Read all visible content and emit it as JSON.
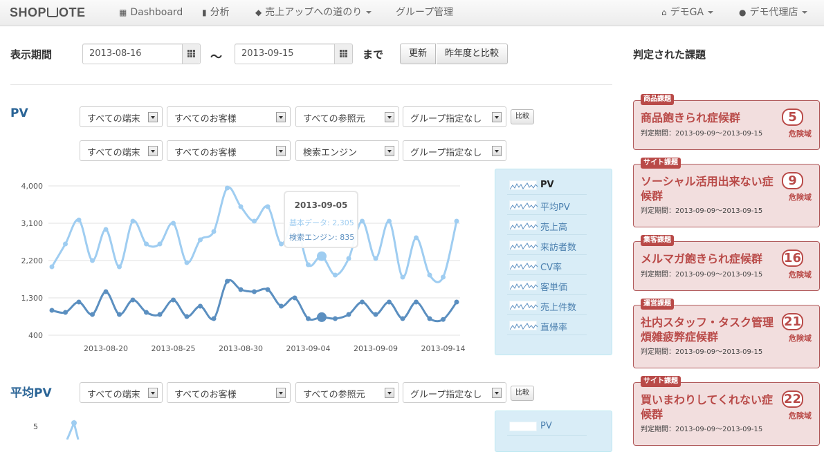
{
  "nav": {
    "brand": "SHOPNOTE",
    "brand_left": "SHOP",
    "brand_right": "OTE",
    "brand_icon": "cart-icon",
    "dashboard": "Dashboard",
    "analysis": "分析",
    "road": "売上アップへの道のり",
    "group": "グループ管理",
    "account": "デモGA",
    "agency": "デモ代理店"
  },
  "period": {
    "label": "表示期間",
    "from": "2013-08-16",
    "tilde": "〜",
    "to": "2013-09-15",
    "until": "まで",
    "refresh": "更新",
    "compare_last_year": "昨年度と比較"
  },
  "pv_section": {
    "title": "PV",
    "filter1": [
      "すべての端末",
      "すべてのお客様",
      "すべての参照元",
      "グループ指定なし"
    ],
    "filter2": [
      "すべての端末",
      "すべてのお客様",
      "検索エンジン",
      "グループ指定なし"
    ],
    "compare": "比較"
  },
  "avg_section": {
    "title": "平均PV",
    "filter1": [
      "すべての端末",
      "すべてのお客様",
      "すべての参照元",
      "グループ指定なし"
    ],
    "compare": "比較",
    "y_tick": "5",
    "legend_first": "PV"
  },
  "legend": [
    "PV",
    "平均PV",
    "売上高",
    "来訪者数",
    "CV率",
    "客単価",
    "売上件数",
    "直帰率"
  ],
  "tooltip": {
    "date": "2013-09-05",
    "row1": "基本データ: 2,305",
    "row2": "検索エンジン: 835"
  },
  "chart_data": {
    "type": "line",
    "x": [
      "2013-08-16",
      "2013-08-17",
      "2013-08-18",
      "2013-08-19",
      "2013-08-20",
      "2013-08-21",
      "2013-08-22",
      "2013-08-23",
      "2013-08-24",
      "2013-08-25",
      "2013-08-26",
      "2013-08-27",
      "2013-08-28",
      "2013-08-29",
      "2013-08-30",
      "2013-08-31",
      "2013-09-01",
      "2013-09-02",
      "2013-09-03",
      "2013-09-04",
      "2013-09-05",
      "2013-09-06",
      "2013-09-07",
      "2013-09-08",
      "2013-09-09",
      "2013-09-10",
      "2013-09-11",
      "2013-09-12",
      "2013-09-13",
      "2013-09-14",
      "2013-09-15"
    ],
    "x_ticks": [
      "2013-08-20",
      "2013-08-25",
      "2013-08-30",
      "2013-09-04",
      "2013-09-09",
      "2013-09-14"
    ],
    "y_ticks": [
      "4,000",
      "3,100",
      "2,200",
      "1,300",
      "400"
    ],
    "ylim": [
      400,
      4000
    ],
    "highlight_date": "2013-09-05",
    "series": [
      {
        "name": "基本データ",
        "color": "#9fcdf1",
        "values": [
          2050,
          2600,
          3180,
          2200,
          2950,
          2050,
          3150,
          2600,
          2600,
          3100,
          2150,
          2700,
          2900,
          3950,
          3500,
          3150,
          3500,
          2600,
          3150,
          2100,
          2305,
          1850,
          2250,
          3150,
          2250,
          3150,
          1800,
          2750,
          1850,
          1800,
          3150
        ]
      },
      {
        "name": "検索エンジン",
        "color": "#5b8fc0",
        "values": [
          1000,
          950,
          1200,
          900,
          1450,
          900,
          1250,
          950,
          900,
          1250,
          850,
          1100,
          800,
          1700,
          1500,
          1450,
          1500,
          1100,
          1300,
          800,
          835,
          800,
          900,
          1200,
          900,
          1200,
          800,
          1200,
          800,
          780,
          1200
        ]
      }
    ]
  },
  "issues_title": "判定された課題",
  "issues": [
    {
      "tag": "商品課題",
      "name": "商品飽きられ症候群",
      "period": "判定期間：2013-09-09～2013-09-15",
      "num": "5",
      "level": "危険域"
    },
    {
      "tag": "サイト課題",
      "name": "ソーシャル活用出来ない症候群",
      "period": "判定期間：2013-09-09～2013-09-15",
      "num": "9",
      "level": "危険域"
    },
    {
      "tag": "集客課題",
      "name": "メルマガ飽きられ症候群",
      "period": "判定期間：2013-09-09～2013-09-15",
      "num": "16",
      "level": "危険域"
    },
    {
      "tag": "運営課題",
      "name": "社内スタッフ・タスク管理煩雑疲弊症候群",
      "period": "判定期間：2013-09-09～2013-09-15",
      "num": "21",
      "level": "危険域"
    },
    {
      "tag": "サイト課題",
      "name": "買いまわりしてくれない症候群",
      "period": "判定期間：2013-09-09～2013-09-15",
      "num": "22",
      "level": "危険域"
    }
  ]
}
